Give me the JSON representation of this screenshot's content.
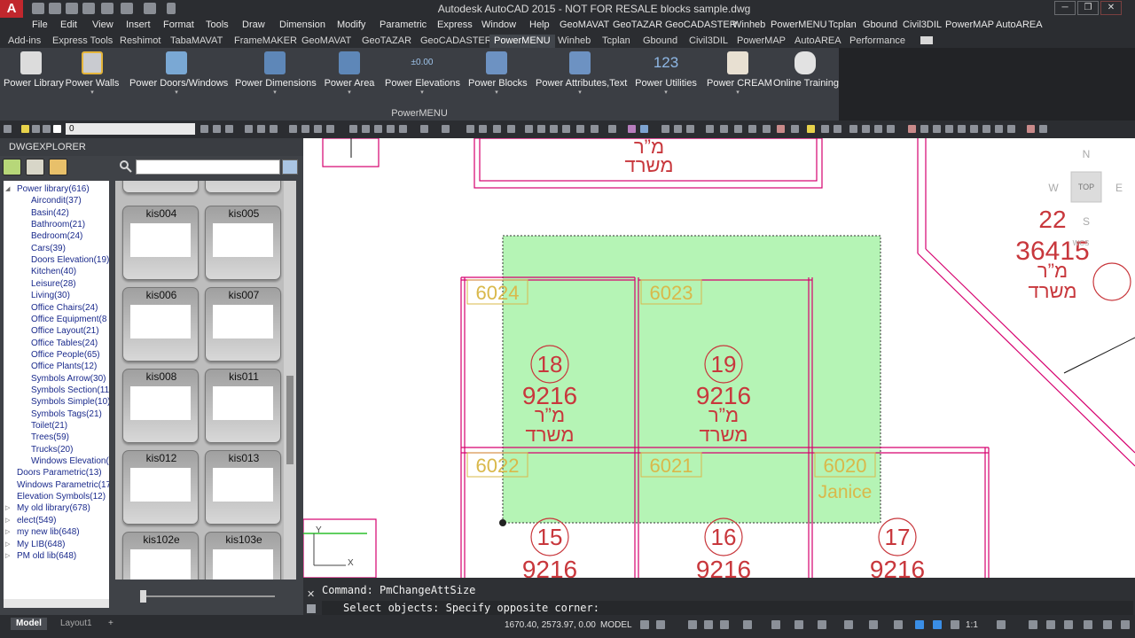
{
  "title_bar": {
    "window_title": "Autodesk AutoCAD 2015 - NOT FOR RESALE   blocks sample.dwg",
    "logo_text": "A",
    "minimize": "─",
    "restore": "❐",
    "close": "✕"
  },
  "menu": [
    "File",
    "Edit",
    "View",
    "Insert",
    "Format",
    "Tools",
    "Draw",
    "Dimension",
    "Modify",
    "Parametric",
    "Express",
    "Window",
    "Help",
    "GeoMAVAT",
    "GeoTAZAR",
    "GeoCADASTER",
    "Winheb",
    "PowerMENU",
    "Tcplan",
    "Gbound",
    "Civil3DIL",
    "PowerMAP",
    "AutoAREA"
  ],
  "ribbon_tabs": {
    "items": [
      "Add-ins",
      "Express Tools",
      "Reshimot",
      "TabaMAVAT",
      "FrameMAKER",
      "GeoMAVAT",
      "GeoTAZAR",
      "GeoCADASTER",
      "PowerMENU",
      "Winheb",
      "Tcplan",
      "Gbound",
      "Civil3DIL",
      "PowerMAP",
      "AutoAREA",
      "Performance"
    ],
    "active": "PowerMENU"
  },
  "ribbon": {
    "panel_title": "PowerMENU",
    "buttons": [
      {
        "label": "Power Library",
        "icon": "library-icon"
      },
      {
        "label": "Power Walls",
        "icon": "walls-icon"
      },
      {
        "label": "Power Doors/Windows",
        "icon": "doors-windows-icon"
      },
      {
        "label": "Power Dimensions",
        "icon": "dimensions-icon"
      },
      {
        "label": "Power Area",
        "icon": "area-icon"
      },
      {
        "label": "Power Elevations",
        "icon": "elevations-icon"
      },
      {
        "label": "Power Blocks",
        "icon": "blocks-icon"
      },
      {
        "label": "Power Attributes,Text",
        "icon": "attributes-text-icon"
      },
      {
        "label": "Power Utilities",
        "icon": "utilities-icon"
      },
      {
        "label": "Power CREAM",
        "icon": "cream-icon"
      },
      {
        "label": "Online Training",
        "icon": "online-training-icon"
      }
    ],
    "elevation_icon_text": "±0.00",
    "utilities_icon_text": "123"
  },
  "toolbar": {
    "layer_value": "0"
  },
  "explorer": {
    "title": "DWGEXPLORER",
    "tree": [
      {
        "label": "Power library(616)",
        "level": 0,
        "expanded": true
      },
      {
        "label": "Aircondit(37)",
        "level": 1
      },
      {
        "label": "Basin(42)",
        "level": 1
      },
      {
        "label": "Bathroom(21)",
        "level": 1
      },
      {
        "label": "Bedroom(24)",
        "level": 1
      },
      {
        "label": "Cars(39)",
        "level": 1
      },
      {
        "label": "Doors Elevation(19)",
        "level": 1
      },
      {
        "label": "Kitchen(40)",
        "level": 1
      },
      {
        "label": "Leisure(28)",
        "level": 1
      },
      {
        "label": "Living(30)",
        "level": 1
      },
      {
        "label": "Office Chairs(24)",
        "level": 1
      },
      {
        "label": "Office Equipment(8",
        "level": 1
      },
      {
        "label": "Office Layout(21)",
        "level": 1
      },
      {
        "label": "Office Tables(24)",
        "level": 1
      },
      {
        "label": "Office People(65)",
        "level": 1
      },
      {
        "label": "Office Plants(12)",
        "level": 1
      },
      {
        "label": "Symbols Arrow(30)",
        "level": 1
      },
      {
        "label": "Symbols Section(11",
        "level": 1
      },
      {
        "label": "Symbols Simple(10)",
        "level": 1
      },
      {
        "label": "Symbols Tags(21)",
        "level": 1
      },
      {
        "label": "Toilet(21)",
        "level": 1
      },
      {
        "label": "Trees(59)",
        "level": 1
      },
      {
        "label": "Trucks(20)",
        "level": 1
      },
      {
        "label": "Windows Elevation(",
        "level": 1
      },
      {
        "label": "Doors Parametric(13)",
        "level": 0
      },
      {
        "label": "Windows Parametric(17",
        "level": 0
      },
      {
        "label": "Elevation Symbols(12)",
        "level": 0
      },
      {
        "label": "My old library(678)",
        "level": 0,
        "collapsed": true
      },
      {
        "label": "elect(549)",
        "level": 0,
        "collapsed": true
      },
      {
        "label": "my new lib(648)",
        "level": 0,
        "collapsed": true
      },
      {
        "label": "My LIB(648)",
        "level": 0,
        "collapsed": true
      },
      {
        "label": "PM old lib(648)",
        "level": 0,
        "collapsed": true
      }
    ],
    "blocks": [
      "kis004",
      "kis005",
      "kis006",
      "kis007",
      "kis008",
      "kis011",
      "kis012",
      "kis013",
      "kis102e",
      "kis103e"
    ]
  },
  "drawing": {
    "rooms_top": [
      {
        "tag": "6024",
        "num": "18",
        "area": "9216",
        "abbr": "מ”ר",
        "name": "משרד"
      },
      {
        "tag": "6023",
        "num": "19",
        "area": "9216",
        "abbr": "מ”ר",
        "name": "משרד"
      }
    ],
    "rooms_bottom": [
      {
        "tag": "6022",
        "num": "15",
        "area": "9216"
      },
      {
        "tag": "6021",
        "num": "16",
        "area": "9216"
      },
      {
        "tag": "6020",
        "num": "17",
        "area": "9216",
        "person": "Janice"
      }
    ],
    "top_room": {
      "abbr": "מ”ר",
      "name": "משרד"
    },
    "right_room": {
      "num": "22",
      "area": "36415",
      "abbr": "מ”ר",
      "name": "משרד"
    },
    "viewcube": {
      "n": "N",
      "s": "S",
      "e": "E",
      "w": "W",
      "top": "TOP",
      "wcs": "WCS"
    },
    "ucs": {
      "x": "X",
      "y": "Y"
    },
    "colors": {
      "walls": "#d6006f",
      "tags": "#d9b84a",
      "labels": "#c8373c",
      "selection": "#8fec8f"
    }
  },
  "command": {
    "history": "Command: PmChangeAttSize",
    "prompt": "Select objects: Specify opposite corner:"
  },
  "status": {
    "tabs": [
      "Model",
      "Layout1"
    ],
    "add_tab": "+",
    "coords": "1670.40, 2573.97, 0.00",
    "mode": "MODEL",
    "scale": "1:1"
  }
}
